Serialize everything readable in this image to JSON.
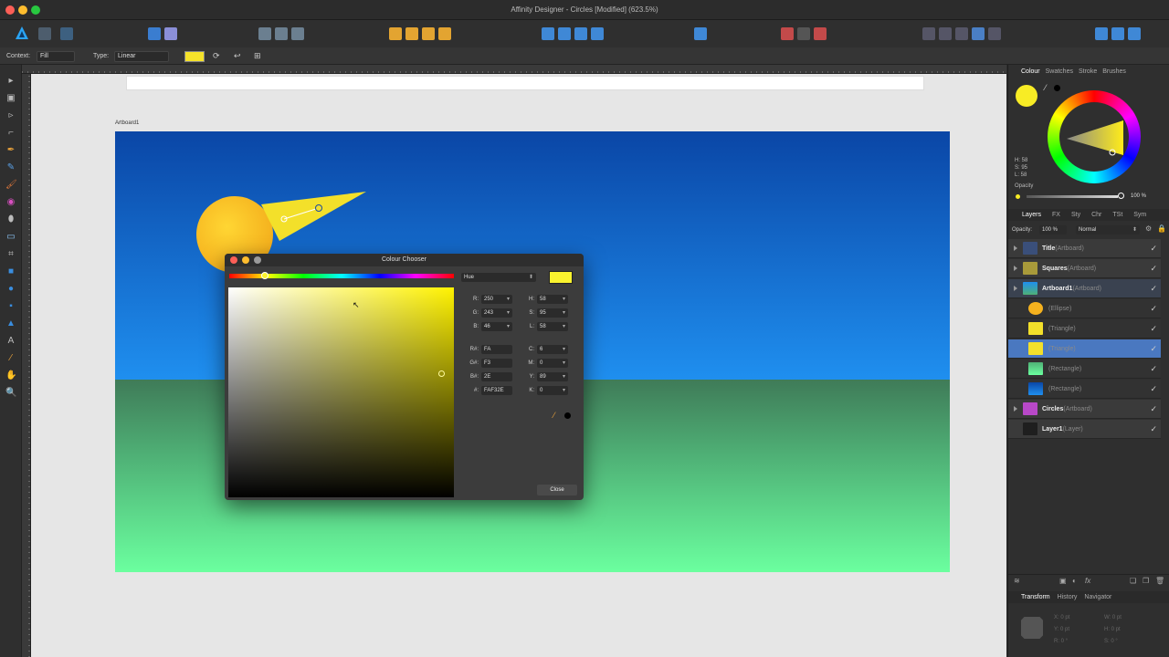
{
  "window": {
    "title": "Affinity Designer - Circles [Modified] (623.5%)"
  },
  "context_bar": {
    "context_label": "Context:",
    "context_value": "Fill",
    "type_label": "Type:",
    "type_value": "Linear",
    "fill_color": "#f5e22a"
  },
  "canvas": {
    "artboard_label": "Artboard1"
  },
  "colour_chooser": {
    "title": "Colour Chooser",
    "mode": "Hue",
    "swatch": "#FAF32E",
    "hue_position": 0.16,
    "r": "250",
    "g": "243",
    "b": "46",
    "rh": "FA",
    "gh": "F3",
    "bh": "2E",
    "hex": "FAF32E",
    "h": "58",
    "s": "95",
    "l": "58",
    "c": "6",
    "m": "0",
    "y": "89",
    "k": "0",
    "labels": {
      "r": "R:",
      "g": "G:",
      "b": "B:",
      "rh": "R#:",
      "gh": "G#:",
      "bh": "B#:",
      "hex": "#:",
      "h": "H:",
      "s": "S:",
      "l": "L:",
      "c": "C:",
      "m": "M:",
      "y": "Y:",
      "k": "K:"
    },
    "close_label": "Close"
  },
  "colour_panel": {
    "tabs": [
      "Colour",
      "Swatches",
      "Stroke",
      "Brushes"
    ],
    "current_color": "#f8ec25",
    "h": "H: 58",
    "s": "S: 95",
    "l": "L: 58",
    "opacity_label": "Opacity",
    "opacity_value": "100 %"
  },
  "layers_panel": {
    "tabs": [
      "Layers",
      "FX",
      "Sty",
      "Chr",
      "TSt",
      "Sym"
    ],
    "opacity_label": "Opacity:",
    "opacity_value": "100 %",
    "blend_mode": "Normal",
    "layers": [
      {
        "name": "Title",
        "kind": "(Artboard)"
      },
      {
        "name": "Squares",
        "kind": "(Artboard)"
      },
      {
        "name": "Artboard1",
        "kind": "(Artboard)"
      },
      {
        "name": "",
        "kind": "(Ellipse)"
      },
      {
        "name": "",
        "kind": "(Triangle)"
      },
      {
        "name": "",
        "kind": "(Triangle)"
      },
      {
        "name": "",
        "kind": "(Rectangle)"
      },
      {
        "name": "",
        "kind": "(Rectangle)"
      },
      {
        "name": "Circles",
        "kind": "(Artboard)"
      },
      {
        "name": "Layer1",
        "kind": "(Layer)"
      }
    ]
  },
  "transform_panel": {
    "tabs": [
      "Transform",
      "History",
      "Navigator"
    ],
    "x": "X:",
    "x_val": "0 pt",
    "w": "W:",
    "w_val": "0 pt",
    "y": "Y:",
    "y_val": "0 pt",
    "h": "H:",
    "h_val": "0 pt",
    "r": "R:",
    "r_val": "0 °",
    "s": "S:",
    "s_val": "0 °"
  }
}
